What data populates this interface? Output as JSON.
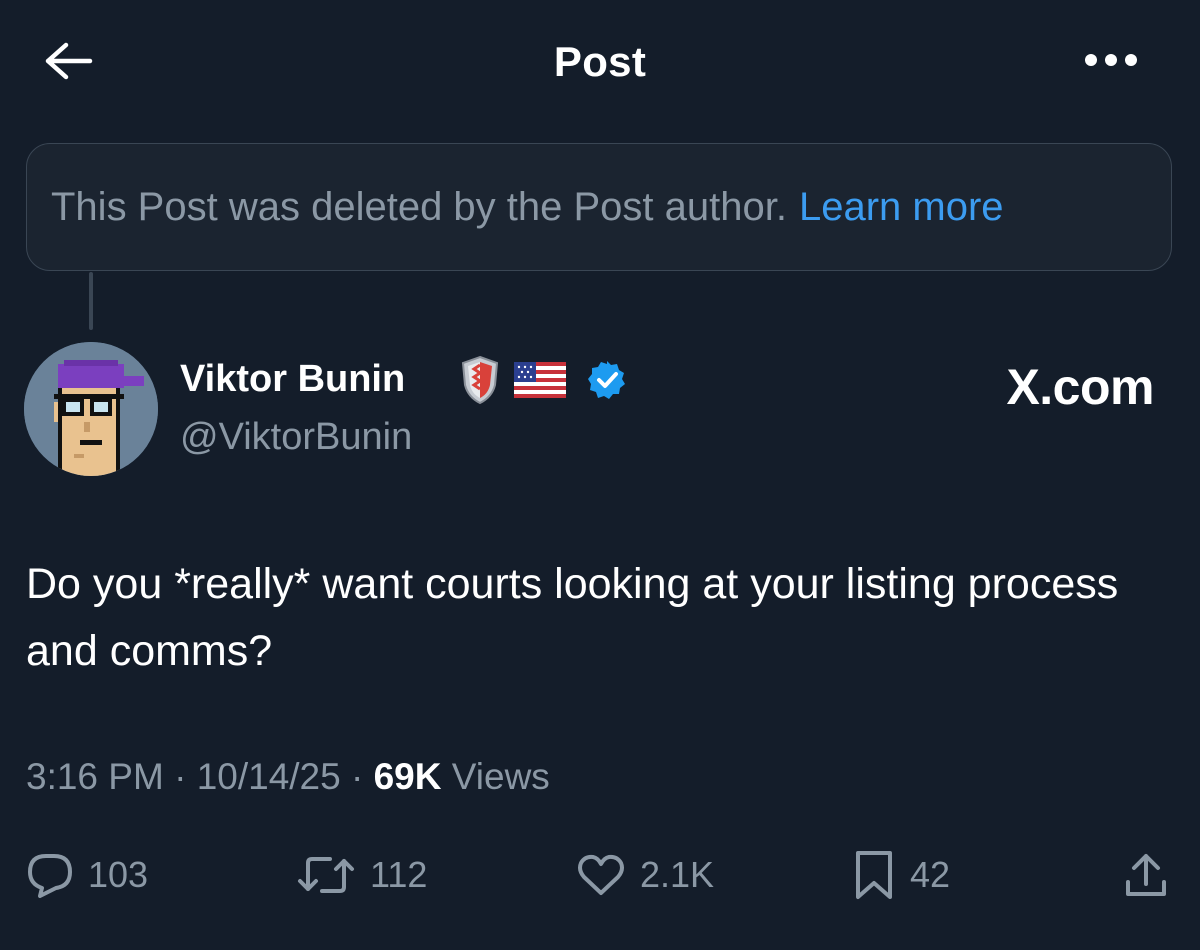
{
  "header": {
    "title": "Post",
    "back_icon": "arrow-left-icon",
    "more_icon": "more-horizontal-icon"
  },
  "deleted_notice": {
    "text": "This Post was deleted by the Post author.",
    "link": "Learn more"
  },
  "author": {
    "name": "Viktor Bunin",
    "handle": "@ViktorBunin",
    "badges": [
      "shield-emoji-icon",
      "us-flag-icon",
      "verified-badge-icon"
    ]
  },
  "watermark": "X.com",
  "post": {
    "text": "Do you *really* want courts looking at your listing process and comms?"
  },
  "meta": {
    "time": "3:16 PM",
    "date": "10/14/25",
    "views_count": "69K",
    "views_label": "Views",
    "separator": "·"
  },
  "actions": {
    "replies": "103",
    "reposts": "112",
    "likes": "2.1K",
    "bookmarks": "42"
  },
  "colors": {
    "background": "#141d2a",
    "text": "#ffffff",
    "secondary": "#8b98a5",
    "link": "#3c9cf0",
    "verified": "#1d9bf0"
  }
}
